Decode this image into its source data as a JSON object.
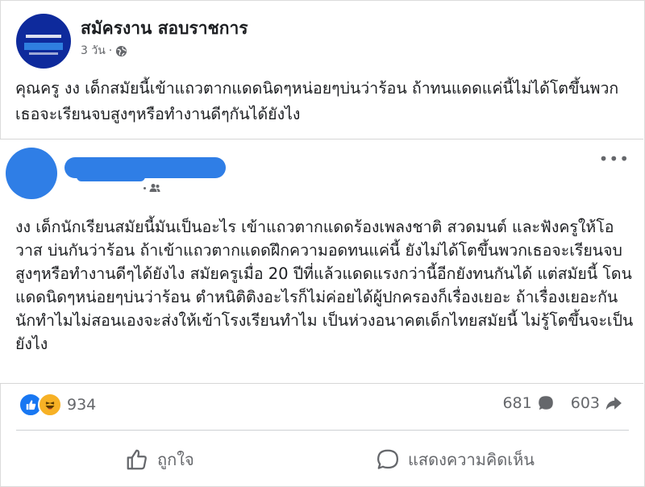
{
  "header": {
    "page_name": "สมัครงาน สอบราชการ",
    "time": "3 วัน",
    "separator": "·",
    "privacy_icon": "globe-icon"
  },
  "post": {
    "text": "คุณครู งง เด็กสมัยนี้เข้าแถวตากแดดนิดๆหน่อยๆบ่นว่าร้อน ถ้าทนแดดแค่นี้ไม่ได้โตขึ้นพวกเธอจะเรียนจบสูงๆหรือทำงานดีๆกันได้ยังไง"
  },
  "shared": {
    "more_icon": "more-options-icon",
    "more_label": "•••",
    "audience_icon": "friends-icon",
    "text": "งง เด็กนักเรียนสมัยนี้มันเป็นอะไร เข้าแถวตากแดดร้องเพลงชาติ สวดมนต์ และฟังครูให้โอวาส บ่นกันว่าร้อน ถ้าเข้าแถวตากแดดฝึกความอดทนแค่นี้ ยังไม่ได้โตขึ้นพวกเธอจะเรียนจบสูงๆหรือทำงานดีๆได้ยังไง สมัยครูเมื่อ 20 ปีที่แล้วแดดแรงกว่านี้อีกยังทนกันได้ แต่สมัยนี้ โดนแดดนิดๆหน่อยๆบ่นว่าร้อน ตำหนิติติงอะไรก็ไม่ค่อยได้ผู้ปกครองก็เรื่องเยอะ ถ้าเรื่องเยอะกันนักทำไมไม่สอนเองจะส่งให้เข้าโรงเรียนทำไม เป็นห่วงอนาคตเด็กไทยสมัยนี้ ไม่รู้โตขึ้นจะเป็นยังไง"
  },
  "stats": {
    "reactions_count": "934",
    "comments_count": "681",
    "shares_count": "603"
  },
  "actions": {
    "like_label": "ถูกใจ",
    "comment_label": "แสดงความคิดเห็น"
  },
  "colors": {
    "accent": "#1877f2",
    "text": "#1c1e21",
    "muted": "#65676b",
    "avatar_bg": "#0e2a9c",
    "redaction": "#2f7ee6"
  }
}
